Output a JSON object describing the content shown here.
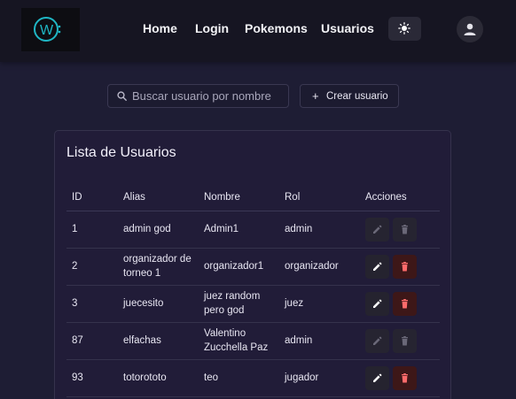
{
  "nav": {
    "logo_letter": "W",
    "links": [
      "Home",
      "Login",
      "Pokemons",
      "Usuarios"
    ]
  },
  "toolbar": {
    "search_placeholder": "Buscar usuario por nombre",
    "create_label": "Crear usuario"
  },
  "card": {
    "title": "Lista de Usuarios",
    "columns": [
      "ID",
      "Alias",
      "Nombre",
      "Rol",
      "Acciones"
    ],
    "rows": [
      {
        "id": "1",
        "alias": "admin god",
        "nombre": "Admin1",
        "rol": "admin",
        "editable": false
      },
      {
        "id": "2",
        "alias": "organizador de torneo 1",
        "nombre": "organizador1",
        "rol": "organizador",
        "editable": true
      },
      {
        "id": "3",
        "alias": "juecesito",
        "nombre": "juez random pero god",
        "rol": "juez",
        "editable": true
      },
      {
        "id": "87",
        "alias": "elfachas",
        "nombre": "Valentino Zucchella Paz",
        "rol": "admin",
        "editable": false
      },
      {
        "id": "93",
        "alias": "totorototo",
        "nombre": "teo",
        "rol": "jugador",
        "editable": true
      }
    ]
  },
  "colors": {
    "accent": "#1fb6c4",
    "delete": "#ff6b6b",
    "background": "#1e1d34"
  }
}
